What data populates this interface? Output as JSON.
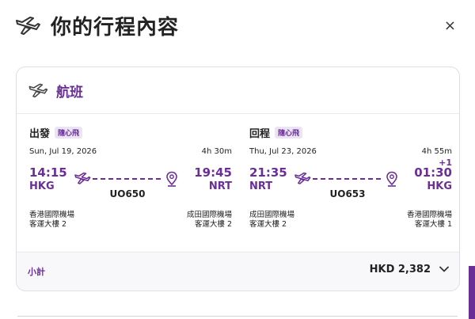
{
  "header": {
    "title": "你的行程內容",
    "icon": "plane-icon",
    "close_icon": "close-icon",
    "close_label": "×"
  },
  "card": {
    "title": "航班",
    "icon": "plane-icon"
  },
  "outbound": {
    "label": "出發",
    "badge": "隨心飛",
    "date": "Sun, Jul 19, 2026",
    "duration": "4h 30m",
    "day_offset": "",
    "dep_time": "14:15",
    "dep_code": "HKG",
    "arr_time": "19:45",
    "arr_code": "NRT",
    "flight_no": "UO650",
    "dep_airport": "香港國際機場",
    "dep_terminal": "客運大樓 2",
    "arr_airport": "成田國際機場",
    "arr_terminal": "客運大樓 2"
  },
  "return": {
    "label": "回程",
    "badge": "隨心飛",
    "date": "Thu, Jul 23, 2026",
    "duration": "4h 55m",
    "day_offset": "+1",
    "dep_time": "21:35",
    "dep_code": "NRT",
    "arr_time": "01:30",
    "arr_code": "HKG",
    "flight_no": "UO653",
    "dep_airport": "成田國際機場",
    "dep_terminal": "客運大樓 2",
    "arr_airport": "香港國際機場",
    "arr_terminal": "客運大樓 1"
  },
  "subtotal": {
    "label": "小計",
    "amount": "HKD 2,382",
    "icon": "chevron-down-icon"
  },
  "colors": {
    "accent": "#6b2e99",
    "badge_bg": "#ece3f5",
    "text": "#222222"
  }
}
